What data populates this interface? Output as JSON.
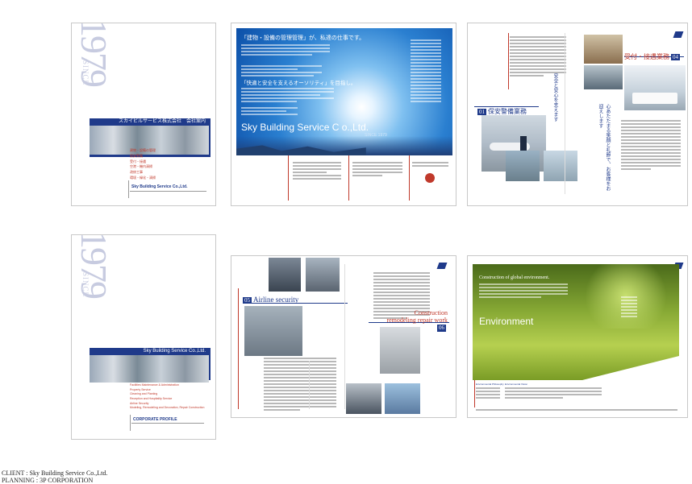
{
  "panels": {
    "p1": {
      "since_label": "SINCE",
      "since_year": "1979",
      "banner_text": "スカイビルサービス株式会社　会社案内",
      "menu": [
        "建物・設備の管理",
        "保安警備",
        "受付・接遇",
        "空港・機内清掃",
        "改修工事",
        "環境・緑化・清掃"
      ],
      "company": "Sky Building Service Co.,Ltd."
    },
    "p2": {
      "headline": "「建物・設備の管理管理」が、私達の仕事です。",
      "headline2": "「快適と安全を支えるオーソリティ」を目指し。",
      "company": "Sky Building Service C o.,Ltd.",
      "since": "SINCE 1979"
    },
    "p3": {
      "security_num": "01",
      "security_title": "保安警備業務",
      "reception_title": "受付・接遇業務",
      "reception_num": "04",
      "vertical1": "安全と安心を支えます",
      "vertical2": "心あたたまる笑顔と礼節で、お客様をお迎えします"
    },
    "p4": {
      "since_label": "SINCE",
      "since_year": "1979",
      "banner_text": "Sky Building Service Co.,Ltd.",
      "menu": [
        "Facilities Maintenance & Administration",
        "Property Service",
        "Cleaning and Planting",
        "Reception and Hospitality Service",
        "Airline Security",
        "Modeling, Remodeling and Decoration, Repair Construction"
      ],
      "profile": "CORPORATE PROFILE"
    },
    "p5": {
      "num1": "05",
      "title1": "Airline security",
      "title2a": "Construction",
      "title2b": "remodeling repair work",
      "num2": "06"
    },
    "p6": {
      "intro": "Construction of global environment.",
      "title": "Environment",
      "sub1": "Environmental Philosophy",
      "sub2": "Environmental Vision"
    }
  },
  "credits": {
    "client": "CLIENT : Sky Building Service Co.,Ltd.",
    "planning": "PLANNING : 3P CORPORATION"
  }
}
